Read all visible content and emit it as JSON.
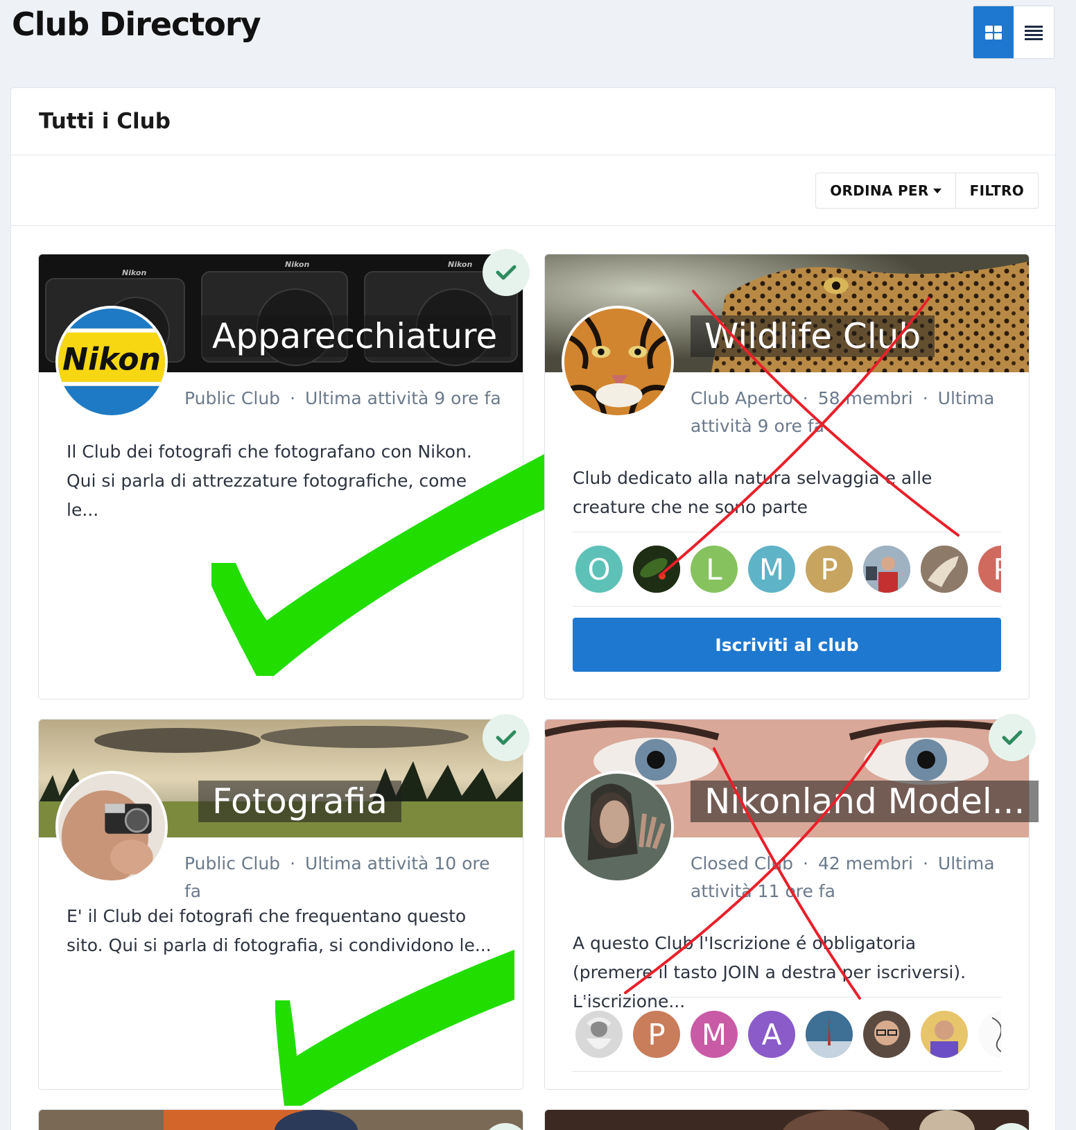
{
  "page": {
    "title": "Club Directory"
  },
  "view_toggle": {
    "grid_icon": "grid-icon",
    "list_icon": "list-icon"
  },
  "panel": {
    "title": "Tutti i Club"
  },
  "toolbar": {
    "sort_label": "ORDINA PER",
    "filter_label": "FILTRO"
  },
  "clubs": [
    {
      "title": "Apparecchiature",
      "type": "Public Club",
      "activity": "Ultima attività 9 ore fa",
      "description": "Il Club dei fotografi che fotografano con Nikon. Qui si parla di attrezzature fotografiche, come le...",
      "joined": true
    },
    {
      "title": "Wildlife Club",
      "type": "Club Aperto",
      "members": "58 membri",
      "activity": "Ultima attività 9 ore fa",
      "description": "Club dedicato alla natura selvaggia e alle creature che ne sono parte",
      "member_initials": [
        "O",
        "",
        "L",
        "M",
        "P",
        "",
        "",
        "P"
      ],
      "join_label": "Iscriviti al club",
      "joined": false
    },
    {
      "title": "Fotografia",
      "type": "Public Club",
      "activity": "Ultima attività 10 ore fa",
      "description": "E' il Club dei fotografi che frequentano questo sito. Qui si parla di fotografia, si condividono le...",
      "joined": true
    },
    {
      "title": "Nikonland Model...",
      "type": "Closed Club",
      "members": "42 membri",
      "activity": "Ultima attività 11 ore fa",
      "description": "A questo Club l'Iscrizione é obbligatoria (premere il tasto JOIN a destra per iscriversi). L'iscrizione...",
      "member_initials": [
        "",
        "P",
        "M",
        "A",
        "",
        "",
        "",
        ""
      ],
      "joined": true
    }
  ],
  "colors": {
    "accent": "#1e78cf",
    "check": "#2e8b5f",
    "annotation_green": "#22dd00",
    "annotation_red": "#e8202a"
  }
}
